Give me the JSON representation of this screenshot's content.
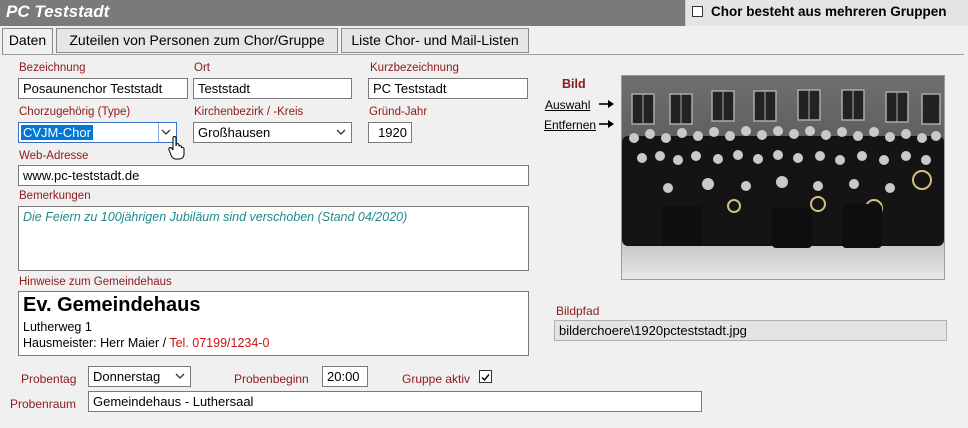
{
  "header": {
    "title": "PC Teststadt",
    "group_checkbox_label": "Chor besteht aus mehreren Gruppen"
  },
  "tabs": [
    {
      "label": "Daten"
    },
    {
      "label": "Zuteilen von Personen zum Chor/Gruppe"
    },
    {
      "label": "Liste Chor- und Mail-Listen"
    }
  ],
  "form": {
    "bezeichnung_label": "Bezeichnung",
    "bezeichnung_value": "Posaunenchor Teststadt",
    "ort_label": "Ort",
    "ort_value": "Teststadt",
    "kurz_label": "Kurzbezeichnung",
    "kurz_value": "PC Teststadt",
    "chorzug_label": "Chorzugehörig (Type)",
    "chorzug_value": "CVJM-Chor",
    "bezirk_label": "Kirchenbezirk / -Kreis",
    "bezirk_value": "Großhausen",
    "jahr_label": "Gründ-Jahr",
    "jahr_value": "1920",
    "web_label": "Web-Adresse",
    "web_value": "www.pc-teststadt.de",
    "bem_label": "Bemerkungen",
    "bem_value": "Die Feiern zu 100jährigen Jubiläum sind verschoben (Stand 04/2020)",
    "hinweis_label": "Hinweise zum Gemeindehaus",
    "hinweis_title": "Ev. Gemeindehaus",
    "hinweis_line1": "Lutherweg 1",
    "hinweis_line2a": "Hausmeister: Herr Maier / ",
    "hinweis_line2b": "Tel. 07199/1234-0",
    "probentag_label": "Probentag",
    "probentag_value": "Donnerstag",
    "probenbeginn_label": "Probenbeginn",
    "probenbeginn_value": "20:00",
    "gruppe_label": "Gruppe aktiv",
    "gruppe_checked": true,
    "probenraum_label": "Probenraum",
    "probenraum_value": "Gemeindehaus - Luthersaal"
  },
  "image_section": {
    "bild_label": "Bild",
    "auswahl_link": "Auswahl",
    "entfernen_link": "Entfernen",
    "bildpfad_label": "Bildpfad",
    "bildpfad_value": "bilderchoere\\1920pcteststadt.jpg"
  },
  "icons": {
    "dropdown": "chevron-down-icon",
    "cursor": "hand-cursor-icon",
    "arrow": "arrow-right-icon",
    "check": "checkmark-icon"
  }
}
